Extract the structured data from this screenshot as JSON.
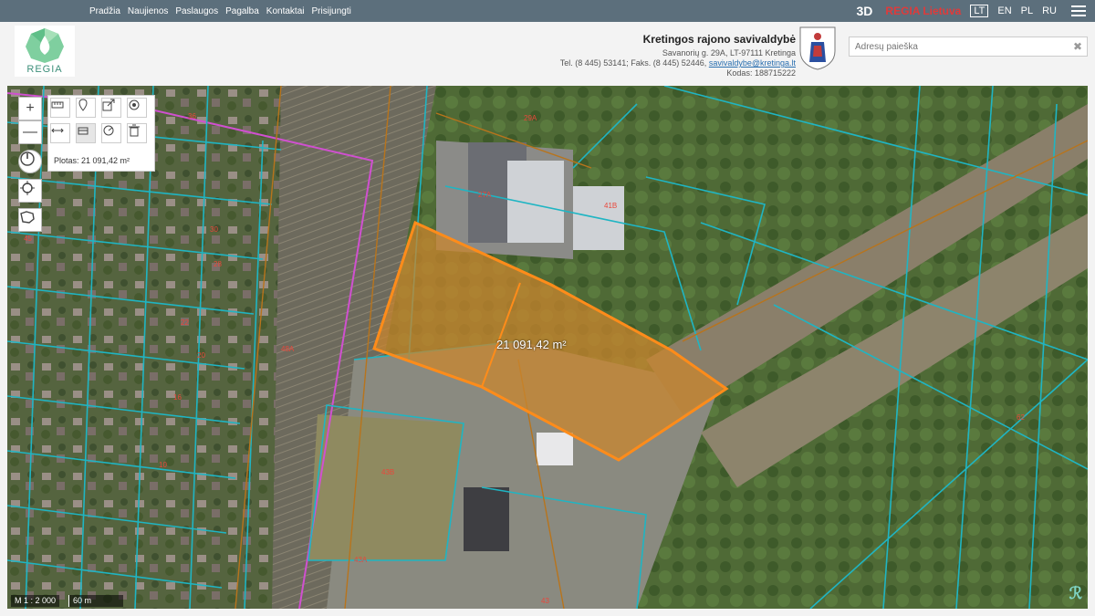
{
  "nav": {
    "items": [
      "Pradžia",
      "Naujienos",
      "Paslaugos",
      "Pagalba",
      "Kontaktai",
      "Prisijungti"
    ],
    "view3d": "3D",
    "brand": "REGIA Lietuva",
    "languages": [
      "LT",
      "EN",
      "PL",
      "RU"
    ],
    "active_language": "LT"
  },
  "logo": {
    "text": "REGIA"
  },
  "municipality": {
    "title": "Kretingos rajono savivaldybė",
    "address": "Savanorių g. 29A, LT-97111 Kretinga",
    "contacts_prefix": "Tel. (8 445) 53141; Faks. (8 445) 52446,",
    "email": "savivaldybe@kretinga.lt",
    "code": "Kodas: 188715222"
  },
  "search": {
    "placeholder": "Adresų paieška",
    "clear": "✖"
  },
  "map": {
    "zoom_in": "+",
    "zoom_out": "—",
    "measurement_label": "Plotas: 21 091,42 m²",
    "area_label": "21 091,42 m²",
    "scale_ratio": "M 1 : 2 000",
    "scale_bar": "60 m",
    "parcel_labels": [
      {
        "text": "29A"
      },
      {
        "text": "41B"
      },
      {
        "text": "27A"
      },
      {
        "text": "48A"
      },
      {
        "text": "43B"
      },
      {
        "text": "43A"
      },
      {
        "text": "43"
      },
      {
        "text": "62"
      },
      {
        "text": "36"
      },
      {
        "text": "30"
      },
      {
        "text": "28"
      },
      {
        "text": "22"
      },
      {
        "text": "20"
      },
      {
        "text": "16"
      },
      {
        "text": "10"
      },
      {
        "text": "45"
      }
    ],
    "colors": {
      "selection_fill": "#c9862e",
      "selection_stroke": "#ff8c1a",
      "parcel_stroke": "#1fb5c3",
      "boundary": "#d050d0"
    }
  }
}
